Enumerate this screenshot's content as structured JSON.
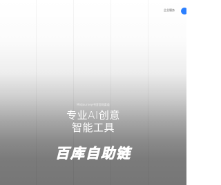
{
  "header": {
    "corp_link": "企业服务"
  },
  "hero": {
    "tagline": "Midjourney中国官网渠道",
    "headline_line1": "专业AI创意",
    "headline_line2": "智能工具"
  },
  "brand": {
    "logo_text": "百库自助链",
    "logo_color": "#ff6f61"
  },
  "colors": {
    "accent": "#2b7fff",
    "brand_orange": "#ff6f61"
  }
}
